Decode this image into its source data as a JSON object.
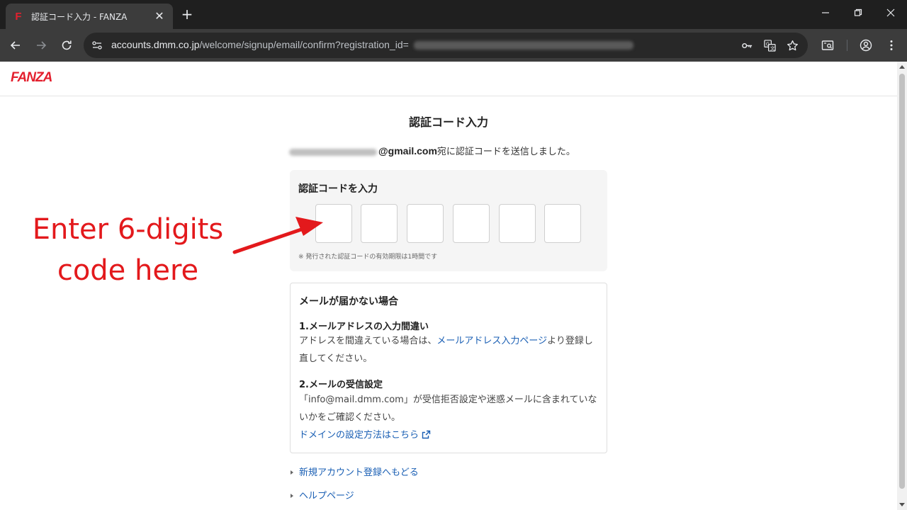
{
  "browser": {
    "tab_title": "認証コード入力 - FANZA",
    "favicon": "F",
    "url_host": "accounts.dmm.co.jp",
    "url_path": "/welcome/signup/email/confirm?registration_id="
  },
  "site": {
    "logo": "FANZA"
  },
  "page": {
    "title": "認証コード入力",
    "sent_email_domain": "@gmail.com",
    "sent_message": "宛に認証コードを送信しました。",
    "code_label": "認証コードを入力",
    "code_note": "※ 発行された認証コードの有効期限は1時間です",
    "digits": [
      "",
      "",
      "",
      "",
      "",
      ""
    ]
  },
  "help": {
    "title": "メールが届かない場合",
    "item1_heading": "1.メールアドレスの入力間違い",
    "item1_text_before": "アドレスを間違えている場合は、",
    "item1_link": "メールアドレス入力ページ",
    "item1_text_after": "より登録し直してください。",
    "item2_heading": "2.メールの受信設定",
    "item2_text": "「info@mail.dmm.com」が受信拒否設定や迷惑メールに含まれていないかをご確認ください。",
    "item2_link": "ドメインの設定方法はこちら"
  },
  "links": {
    "back_to_signup": "新規アカウント登録へもどる",
    "help_page": "ヘルプページ"
  },
  "annotation": {
    "line1": "Enter 6-digits",
    "line2": "code here",
    "color": "#e3191c"
  }
}
